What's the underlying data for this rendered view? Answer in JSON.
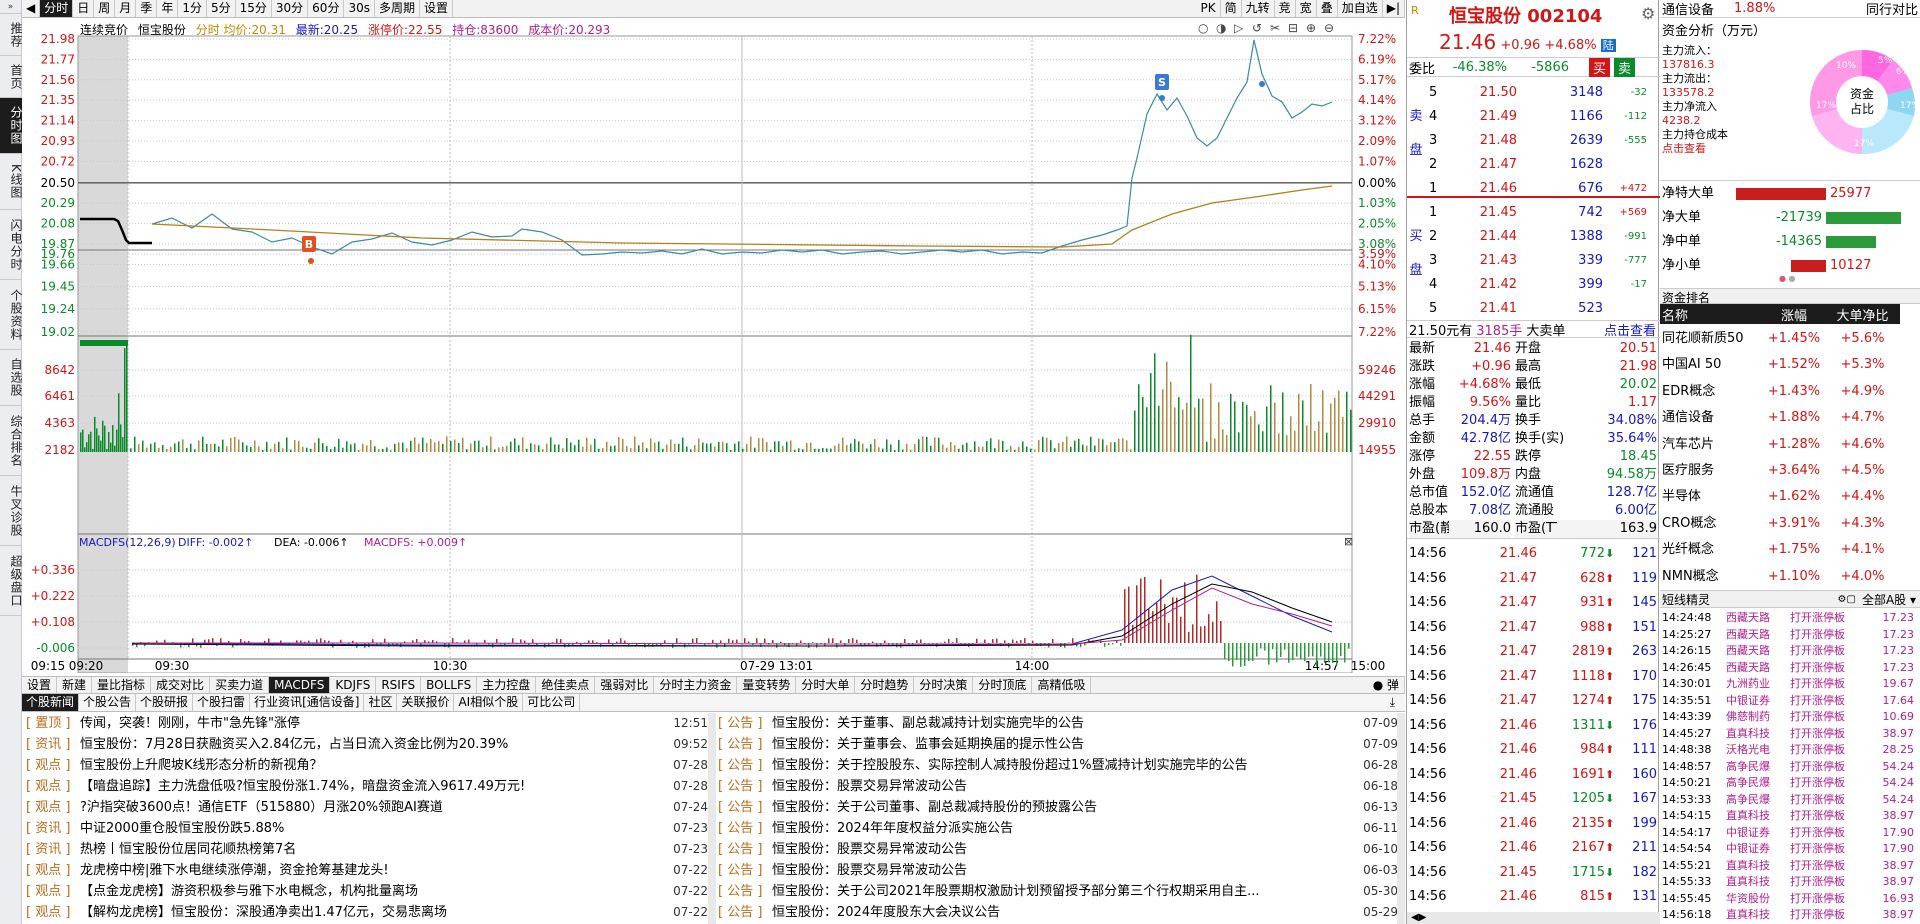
{
  "leftnav": [
    "推荐",
    "首页",
    "分时图",
    "K线图",
    "闪电分时",
    "个股资料",
    "自选股",
    "综合排名",
    "牛叉诊股",
    "超级盘口"
  ],
  "toolbar": {
    "items": [
      "分时",
      "日",
      "周",
      "月",
      "季",
      "年",
      "1分",
      "5分",
      "15分",
      "30分",
      "60分",
      "30s",
      "多周期",
      "设置"
    ],
    "right_items": [
      "PK",
      "简",
      "九转",
      "竞",
      "宽",
      "叠",
      "加自选"
    ]
  },
  "info": {
    "mode": "连续竞价",
    "stock": "恒宝股份",
    "labels": "分时 均价:",
    "avg": "20.31",
    "latest_label": "最新:",
    "latest": "20.25",
    "limit_label": "涨停价:",
    "limit": "22.55",
    "pos_label": "持仓:",
    "pos": "83600",
    "cost_label": "成本价:",
    "cost": "20.293"
  },
  "chart": {
    "price_labels": [
      "21.98",
      "21.77",
      "21.56",
      "21.35",
      "21.14",
      "20.93",
      "20.72",
      "20.50",
      "20.29",
      "20.08",
      "19.87",
      "19.76",
      "19.66",
      "19.45",
      "19.24",
      "19.02"
    ],
    "pct_labels": [
      "7.22%",
      "6.19%",
      "5.17%",
      "4.14%",
      "3.12%",
      "2.09%",
      "1.07%",
      "0.00%",
      "1.03%",
      "2.05%",
      "3.08%",
      "3.59%",
      "4.10%",
      "5.13%",
      "6.15%",
      "7.22%"
    ],
    "vol_labels": [
      "8642",
      "6461",
      "4363",
      "2182"
    ],
    "vol_right": [
      "59246",
      "44291",
      "29910",
      "14955"
    ],
    "macd_title": "MACDFS(12,26,9)",
    "macd_diff": "DIFF: -0.002↑",
    "macd_dea": "DEA: -0.006↑",
    "macd_macdfs": "MACDFS: +0.009↑",
    "macd_labels": [
      "+0.336",
      "+0.222",
      "+0.108",
      "-0.006"
    ],
    "time_labels": [
      "09:15",
      "09:20",
      "09:30",
      "10:30",
      "07-29 13:01",
      "14:00",
      "14:57",
      "15:00"
    ],
    "buy_marker": "B",
    "sell_marker": "S"
  },
  "indicator_tabs": [
    "设置",
    "新建",
    "量比指标",
    "成交对比",
    "买卖力道",
    "MACDFS",
    "KDJFS",
    "RSIFS",
    "BOLLFS",
    "主力控盘",
    "绝佳卖点",
    "强弱对比",
    "分时主力资金",
    "量变转势",
    "分时大单",
    "分时趋势",
    "分时决策",
    "分时顶底",
    "高精低吸"
  ],
  "indicator_right": "弹",
  "news_tabs": [
    "个股新闻",
    "个股公告",
    "个股研报",
    "个股扫雷",
    "行业资讯[通信设备]",
    "社区",
    "关联报价",
    "AI相似个股",
    "可比公司"
  ],
  "news_left": [
    {
      "cat": "置顶",
      "title": "传闻，突袭！刚刚，牛市\"急先锋\"涨停",
      "date": "12:51"
    },
    {
      "cat": "资讯",
      "title": "恒宝股份：7月28日获融资买入2.84亿元，占当日流入资金比例为20.39%",
      "date": "09:52"
    },
    {
      "cat": "观点",
      "title": "恒宝股份上升爬坡K线形态分析的新视角？",
      "date": "07-28"
    },
    {
      "cat": "观点",
      "title": "【暗盘追踪】主力洗盘低吸?恒宝股份涨1.74%，暗盘资金流入9617.49万元!",
      "date": "07-28"
    },
    {
      "cat": "观点",
      "title": "?沪指突破3600点！通信ETF（515880）月涨20%领跑AI赛道",
      "date": "07-24"
    },
    {
      "cat": "资讯",
      "title": "中证2000重仓股恒宝股份跌5.88%",
      "date": "07-23"
    },
    {
      "cat": "资讯",
      "title": "热榜丨恒宝股份位居同花顺热榜第7名",
      "date": "07-23"
    },
    {
      "cat": "观点",
      "title": "龙虎榜中榜|雅下水电继续涨停潮，资金抢筹基建龙头!",
      "date": "07-22"
    },
    {
      "cat": "观点",
      "title": "【点金龙虎榜】游资积极参与雅下水电概念，机构批量离场",
      "date": "07-22"
    },
    {
      "cat": "观点",
      "title": "【解构龙虎榜】恒宝股份：深股通净卖出1.47亿元，交易悲离场",
      "date": "07-22"
    }
  ],
  "news_right": [
    {
      "cat": "公告",
      "title": "恒宝股份：关于董事、副总裁减持计划实施完毕的公告",
      "date": "07-09"
    },
    {
      "cat": "公告",
      "title": "恒宝股份：关于董事会、监事会延期换届的提示性公告",
      "date": "07-09"
    },
    {
      "cat": "公告",
      "title": "恒宝股份：关于控股股东、实际控制人减持股份超过1%暨减持计划实施完毕的公告",
      "date": "06-28"
    },
    {
      "cat": "公告",
      "title": "恒宝股份：股票交易异常波动公告",
      "date": "06-18"
    },
    {
      "cat": "公告",
      "title": "恒宝股份：关于公司董事、副总裁减持股份的预披露公告",
      "date": "06-13"
    },
    {
      "cat": "公告",
      "title": "恒宝股份：2024年年度权益分派实施公告",
      "date": "06-11"
    },
    {
      "cat": "公告",
      "title": "恒宝股份：股票交易异常波动公告",
      "date": "06-10"
    },
    {
      "cat": "公告",
      "title": "恒宝股份：股票交易异常波动公告",
      "date": "06-03"
    },
    {
      "cat": "公告",
      "title": "恒宝股份：关于公司2021年股票期权激励计划预留授予部分第三个行权期采用自主...",
      "date": "05-30"
    },
    {
      "cat": "公告",
      "title": "恒宝股份：2024年度股东大会决议公告",
      "date": "05-29"
    }
  ],
  "quote": {
    "name": "恒宝股份",
    "code": "002104",
    "price": "21.46",
    "change": "+0.96",
    "pct": "+4.68%",
    "tag": "陆",
    "weibi_label": "委比",
    "weibi": "-46.38%",
    "weicha": "-5866",
    "buy_btn": "买",
    "sell_btn": "卖",
    "sell_label": "卖盘",
    "buy_label": "买盘",
    "sells": [
      {
        "lv": "5",
        "p": "21.50",
        "v": "3148",
        "d": "-32"
      },
      {
        "lv": "4",
        "p": "21.49",
        "v": "1166",
        "d": "-112"
      },
      {
        "lv": "3",
        "p": "21.48",
        "v": "2639",
        "d": "-555"
      },
      {
        "lv": "2",
        "p": "21.47",
        "v": "1628",
        "d": ""
      },
      {
        "lv": "1",
        "p": "21.46",
        "v": "676",
        "d": "+472"
      }
    ],
    "buys": [
      {
        "lv": "1",
        "p": "21.45",
        "v": "742",
        "d": "+569"
      },
      {
        "lv": "2",
        "p": "21.44",
        "v": "1388",
        "d": "-991"
      },
      {
        "lv": "3",
        "p": "21.43",
        "v": "339",
        "d": "-777"
      },
      {
        "lv": "4",
        "p": "21.42",
        "v": "399",
        "d": "-17"
      },
      {
        "lv": "5",
        "p": "21.41",
        "v": "523",
        "d": ""
      }
    ],
    "bigorder": {
      "price": "21.50元有",
      "hands": "3185手",
      "label": "大卖单",
      "link": "点击查看"
    },
    "stats": [
      [
        "最新",
        "21.46",
        "开盘",
        "20.51"
      ],
      [
        "涨跌",
        "+0.96",
        "最高",
        "21.98"
      ],
      [
        "涨幅",
        "+4.68%",
        "最低",
        "20.02"
      ],
      [
        "振幅",
        "9.56%",
        "量比",
        "1.17"
      ],
      [
        "总手",
        "204.4万",
        "换手",
        "34.08%"
      ],
      [
        "金额",
        "42.78亿",
        "换手(实)",
        "35.64%"
      ],
      [
        "涨停",
        "22.55",
        "跌停",
        "18.45"
      ],
      [
        "外盘",
        "109.8万",
        "内盘",
        "94.58万"
      ],
      [
        "总市值",
        "152.0亿",
        "流通值",
        "128.7亿"
      ],
      [
        "总股本",
        "7.08亿",
        "流通股",
        "6.00亿"
      ],
      [
        "市盈(静)",
        "160.0",
        "市盈(TTM)",
        "163.9"
      ]
    ],
    "ticks": [
      {
        "t": "14:56",
        "p": "21.46",
        "v": "772",
        "dir": "down",
        "n": "121"
      },
      {
        "t": "14:56",
        "p": "21.47",
        "v": "628",
        "dir": "up",
        "n": "119"
      },
      {
        "t": "14:56",
        "p": "21.47",
        "v": "931",
        "dir": "up",
        "n": "145"
      },
      {
        "t": "14:56",
        "p": "21.47",
        "v": "988",
        "dir": "up",
        "n": "151"
      },
      {
        "t": "14:56",
        "p": "21.47",
        "v": "2819",
        "dir": "up",
        "n": "263"
      },
      {
        "t": "14:56",
        "p": "21.47",
        "v": "1118",
        "dir": "up",
        "n": "170"
      },
      {
        "t": "14:56",
        "p": "21.47",
        "v": "1274",
        "dir": "up",
        "n": "175"
      },
      {
        "t": "14:56",
        "p": "21.46",
        "v": "1311",
        "dir": "down",
        "n": "176"
      },
      {
        "t": "14:56",
        "p": "21.46",
        "v": "984",
        "dir": "up",
        "n": "111"
      },
      {
        "t": "14:56",
        "p": "21.46",
        "v": "1691",
        "dir": "up",
        "n": "160"
      },
      {
        "t": "14:56",
        "p": "21.45",
        "v": "1205",
        "dir": "down",
        "n": "167"
      },
      {
        "t": "14:56",
        "p": "21.46",
        "v": "2135",
        "dir": "up",
        "n": "199"
      },
      {
        "t": "14:56",
        "p": "21.46",
        "v": "2167",
        "dir": "up",
        "n": "211"
      },
      {
        "t": "14:56",
        "p": "21.45",
        "v": "1715",
        "dir": "down",
        "n": "182"
      },
      {
        "t": "14:56",
        "p": "21.46",
        "v": "815",
        "dir": "up",
        "n": "131"
      }
    ]
  },
  "right": {
    "sector": "通信设备",
    "sector_pct": "1.88%",
    "sector_link": "同行对比",
    "fund_title": "资金分析（万元）",
    "fund_lines": [
      "主力流入：",
      "137816.3",
      "主力流出：",
      "133578.2",
      "主力净流入",
      "4238.2",
      "主力持仓成本",
      "点击查看"
    ],
    "donut_center": "资金占比",
    "donut_pcts": [
      "5%",
      "6%",
      "10%",
      "17%",
      "17%",
      "17%"
    ],
    "net": [
      {
        "label": "净特大单",
        "val": "25977"
      },
      {
        "label": "净大单",
        "val": "-21739"
      },
      {
        "label": "净中单",
        "val": "-14365"
      },
      {
        "label": "净小单",
        "val": "10127"
      }
    ],
    "rank_title": "资金排名",
    "rank_headers": [
      "名称",
      "涨幅",
      "大单净比"
    ],
    "ranks": [
      [
        "同花顺新质50",
        "+1.45%",
        "+5.6%"
      ],
      [
        "中国AI 50",
        "+1.52%",
        "+5.3%"
      ],
      [
        "EDR概念",
        "+1.43%",
        "+4.9%"
      ],
      [
        "通信设备",
        "+1.88%",
        "+4.7%"
      ],
      [
        "汽车芯片",
        "+1.28%",
        "+4.6%"
      ],
      [
        "医疗服务",
        "+3.64%",
        "+4.5%"
      ],
      [
        "半导体",
        "+1.62%",
        "+4.4%"
      ],
      [
        "CRO概念",
        "+3.91%",
        "+4.3%"
      ],
      [
        "光纤概念",
        "+1.75%",
        "+4.1%"
      ],
      [
        "NMN概念",
        "+1.10%",
        "+4.0%"
      ]
    ],
    "short_title": "短线精灵",
    "short_filter": "全部A股",
    "shorts": [
      [
        "14:24:48",
        "西藏天路",
        "打开涨停板",
        "17.23"
      ],
      [
        "14:25:27",
        "西藏天路",
        "打开涨停板",
        "17.23"
      ],
      [
        "14:26:15",
        "西藏天路",
        "打开涨停板",
        "17.23"
      ],
      [
        "14:26:45",
        "西藏天路",
        "打开涨停板",
        "17.23"
      ],
      [
        "14:30:01",
        "九洲药业",
        "打开涨停板",
        "19.67"
      ],
      [
        "14:35:51",
        "中银证券",
        "打开涨停板",
        "17.64"
      ],
      [
        "14:43:39",
        "佛慈制药",
        "打开涨停板",
        "10.69"
      ],
      [
        "14:45:27",
        "直真科技",
        "打开涨停板",
        "38.97"
      ],
      [
        "14:48:38",
        "沃格光电",
        "打开涨停板",
        "28.25"
      ],
      [
        "14:48:57",
        "高争民爆",
        "打开涨停板",
        "54.24"
      ],
      [
        "14:50:21",
        "高争民爆",
        "打开涨停板",
        "54.24"
      ],
      [
        "14:53:33",
        "高争民爆",
        "打开涨停板",
        "54.24"
      ],
      [
        "14:54:15",
        "直真科技",
        "打开涨停板",
        "38.97"
      ],
      [
        "14:54:17",
        "中银证券",
        "打开涨停板",
        "17.90"
      ],
      [
        "14:54:54",
        "中银证券",
        "打开涨停板",
        "17.90"
      ],
      [
        "14:55:21",
        "直真科技",
        "打开涨停板",
        "38.97"
      ],
      [
        "14:55:33",
        "直真科技",
        "打开涨停板",
        "38.97"
      ],
      [
        "14:55:45",
        "华资股份",
        "打开涨停板",
        "16.93"
      ],
      [
        "14:56:18",
        "直真科技",
        "打开涨停板",
        "38.97"
      ]
    ]
  }
}
